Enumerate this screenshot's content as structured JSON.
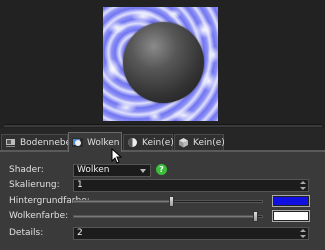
{
  "tabs": [
    {
      "label": "Bodennebel",
      "icon": "fog-icon",
      "active": false
    },
    {
      "label": "Wolken",
      "icon": "clouds-icon",
      "active": true
    },
    {
      "label": "Kein(e)",
      "icon": "half-moon-icon",
      "active": false
    },
    {
      "label": "Kein(e)",
      "icon": "cube-icon",
      "active": false
    }
  ],
  "panel": {
    "shader": {
      "label": "Shader:",
      "value": "Wolken",
      "help": "?"
    },
    "scaling": {
      "label": "Skalierung:",
      "value": "1"
    },
    "background_color": {
      "label": "Hintergrundfarbe:",
      "color": "#1010e0",
      "slider_level": 0.52
    },
    "cloud_color": {
      "label": "Wolkenfarbe:",
      "color": "#ffffff",
      "slider_level": 0.97
    },
    "details": {
      "label": "Details:",
      "value": "2"
    }
  },
  "colors": {
    "accent_blue": "#1010e0",
    "help_green": "#3bbf3b"
  }
}
